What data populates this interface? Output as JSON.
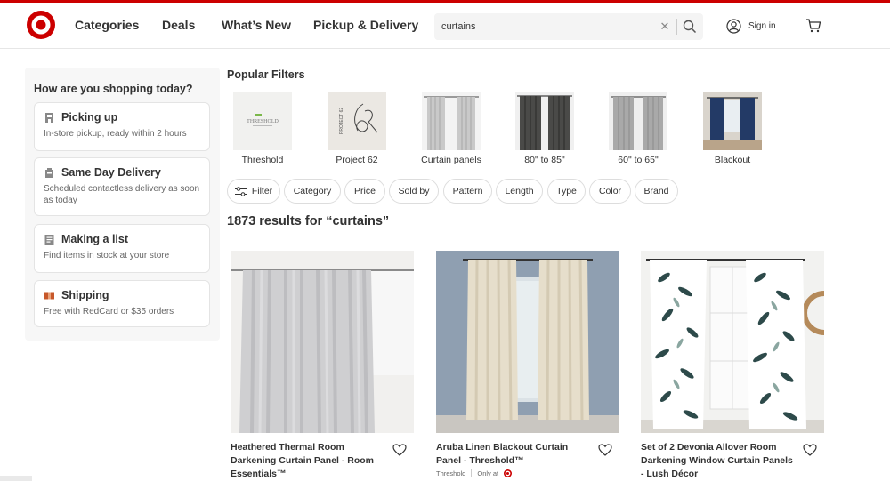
{
  "brand": {
    "accent": "#cc0000"
  },
  "header": {
    "nav": [
      "Categories",
      "Deals",
      "What’s New",
      "Pickup & Delivery"
    ],
    "search": {
      "value": "curtains",
      "placeholder": "Search"
    },
    "sign_in": "Sign in"
  },
  "sidebar": {
    "heading": "How are you shopping today?",
    "options": [
      {
        "icon": "store-pickup-icon",
        "title": "Picking up",
        "desc": "In-store pickup, ready within 2 hours"
      },
      {
        "icon": "same-day-delivery-icon",
        "title": "Same Day Delivery",
        "desc": "Scheduled contactless delivery as soon as today"
      },
      {
        "icon": "shopping-list-icon",
        "title": "Making a list",
        "desc": "Find items in stock at your store"
      },
      {
        "icon": "shipping-box-icon",
        "title": "Shipping",
        "desc": "Free with RedCard or $35 orders"
      }
    ]
  },
  "popular_filters": {
    "heading": "Popular Filters",
    "items": [
      {
        "label": "Threshold",
        "logo_text": "THRESHOLD"
      },
      {
        "label": "Project 62",
        "logo_text": "PROJECT 62"
      },
      {
        "label": "Curtain panels"
      },
      {
        "label": "80\" to 85\""
      },
      {
        "label": "60\" to 65\""
      },
      {
        "label": "Blackout"
      }
    ]
  },
  "filter_chips": [
    "Filter",
    "Category",
    "Price",
    "Sold by",
    "Pattern",
    "Length",
    "Type",
    "Color",
    "Brand"
  ],
  "results": {
    "text": "1873 results for “curtains”"
  },
  "products": [
    {
      "name": "Heathered Thermal Room Darkening Curtain Panel - Room Essentials™"
    },
    {
      "name": "Aruba Linen Blackout Curtain Panel - Threshold™",
      "brand": "Threshold",
      "availability": "Only at"
    },
    {
      "name": "Set of 2 Devonia Allover Room Darkening Window Curtain Panels - Lush Décor"
    }
  ]
}
